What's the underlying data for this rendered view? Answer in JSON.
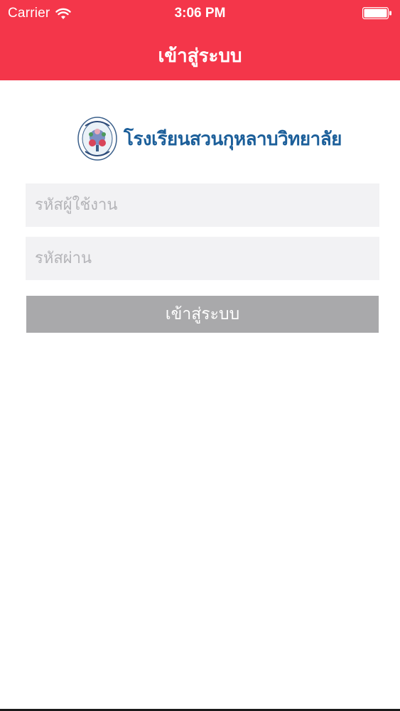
{
  "status_bar": {
    "carrier": "Carrier",
    "time": "3:06 PM",
    "wifi_icon": "wifi-icon",
    "battery_icon": "battery-icon"
  },
  "header": {
    "title": "เข้าสู่ระบบ",
    "background_color": "#f4364a"
  },
  "logo": {
    "school_name": "โรงเรียนสวนกุหลาบวิทยาลัย",
    "seal_icon": "school-seal-icon",
    "name_color": "#1c5f9a"
  },
  "form": {
    "username_placeholder": "รหัสผู้ใช้งาน",
    "username_value": "",
    "password_placeholder": "รหัสผ่าน",
    "password_value": "",
    "login_label": "เข้าสู่ระบบ",
    "field_background": "#f2f2f4",
    "button_color": "#a9a9ab"
  }
}
